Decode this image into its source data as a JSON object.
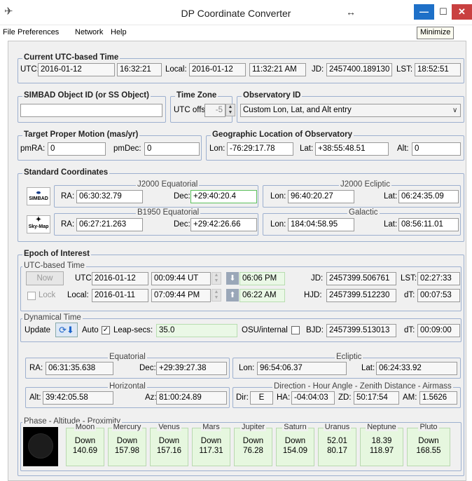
{
  "window": {
    "title": "DP Coordinate Converter",
    "tooltip": "Minimize"
  },
  "menu": [
    "File",
    "Preferences",
    "Network",
    "Help"
  ],
  "current_time": {
    "title": "Current UTC-based Time",
    "utc_label": "UTC:",
    "utc_date": "2016-01-12",
    "utc_time": "16:32:21",
    "local_label": "Local:",
    "local_date": "2016-01-12",
    "local_time": "11:32:21 AM",
    "jd_label": "JD:",
    "jd": "2457400.189130",
    "lst_label": "LST:",
    "lst": "18:52:51"
  },
  "simbad": {
    "title": "SIMBAD Object ID (or SS Object)",
    "value": ""
  },
  "timezone": {
    "title": "Time Zone",
    "label": "UTC offset",
    "value": "-5"
  },
  "observatory": {
    "title": "Observatory ID",
    "value": "Custom Lon, Lat, and Alt entry"
  },
  "proper_motion": {
    "title": "Target Proper Motion (mas/yr)",
    "pmra_label": "pmRA:",
    "pmra": "0",
    "pmdec_label": "pmDec:",
    "pmdec": "0"
  },
  "geo": {
    "title": "Geographic Location of Observatory",
    "lon_label": "Lon:",
    "lon": "-76:29:17.78",
    "lat_label": "Lat:",
    "lat": "+38:55:48.51",
    "alt_label": "Alt:",
    "alt": "0"
  },
  "standard": {
    "title": "Standard Coordinates",
    "j2000_title": "J2000 Equatorial",
    "j2000_ra_label": "RA:",
    "j2000_ra": "06:30:32.79",
    "j2000_dec_label": "Dec:",
    "j2000_dec": "+29:40:20.4",
    "ecl_title": "J2000 Ecliptic",
    "ecl_lon_label": "Lon:",
    "ecl_lon": "96:40:20.27",
    "ecl_lat_label": "Lat:",
    "ecl_lat": "06:24:35.09",
    "b1950_title": "B1950 Equatorial",
    "b1950_ra_label": "RA:",
    "b1950_ra": "06:27:21.263",
    "b1950_dec_label": "Dec:",
    "b1950_dec": "+29:42:26.66",
    "gal_title": "Galactic",
    "gal_lon_label": "Lon:",
    "gal_lon": "184:04:58.95",
    "gal_lat_label": "Lat:",
    "gal_lat": "08:56:11.01",
    "simbad_logo": "SIMBAD",
    "skymap_logo": "Sky-Map"
  },
  "epoch": {
    "title": "Epoch of Interest",
    "utc_title": "UTC-based Time",
    "now_button": "Now",
    "lock_label": "Lock",
    "utc_label": "UTC:",
    "utc_date": "2016-01-12",
    "utc_time": "00:09:44 UT",
    "local_label": "Local:",
    "local_date": "2016-01-11",
    "local_time": "07:09:44 PM",
    "set_time": "06:06 PM",
    "rise_time": "06:22 AM",
    "jd_label": "JD:",
    "jd": "2457399.506761",
    "lst_label": "LST:",
    "lst": "02:27:33",
    "hjd_label": "HJD:",
    "hjd": "2457399.512230",
    "dt_label": "dT:",
    "dt": "00:07:53"
  },
  "dynamical": {
    "title": "Dynamical Time",
    "update_label": "Update",
    "auto_label": "Auto",
    "leap_label": "Leap-secs:",
    "leap": "35.0",
    "osu_label": "OSU/internal",
    "bjd_label": "BJD:",
    "bjd": "2457399.513013",
    "dt_label": "dT:",
    "dt": "00:09:00"
  },
  "eq": {
    "title": "Equatorial",
    "ra_label": "RA:",
    "ra": "06:31:35.638",
    "dec_label": "Dec:",
    "dec": "+29:39:27.38"
  },
  "ecl": {
    "title": "Ecliptic",
    "lon_label": "Lon:",
    "lon": "96:54:06.37",
    "lat_label": "Lat:",
    "lat": "06:24:33.92"
  },
  "hor": {
    "title": "Horizontal",
    "alt_label": "Alt:",
    "alt": "39:42:05.58",
    "az_label": "Az:",
    "az": "81:00:24.89"
  },
  "direction": {
    "title": "Direction - Hour Angle - Zenith Distance - Airmass",
    "dir_label": "Dir:",
    "dir": "E",
    "ha_label": "HA:",
    "ha": "-04:04:03",
    "zd_label": "ZD:",
    "zd": "50:17:54",
    "am_label": "AM:",
    "am": "1.5626"
  },
  "phase": {
    "title": "Phase - Altitude - Proximity",
    "planets": [
      {
        "name": "Moon",
        "alt": "Down",
        "prox": "140.69"
      },
      {
        "name": "Mercury",
        "alt": "Down",
        "prox": "157.98"
      },
      {
        "name": "Venus",
        "alt": "Down",
        "prox": "157.16"
      },
      {
        "name": "Mars",
        "alt": "Down",
        "prox": "117.31"
      },
      {
        "name": "Jupiter",
        "alt": "Down",
        "prox": "76.28"
      },
      {
        "name": "Saturn",
        "alt": "Down",
        "prox": "154.09"
      },
      {
        "name": "Uranus",
        "alt": "52.01",
        "prox": "80.17"
      },
      {
        "name": "Neptune",
        "alt": "18.39",
        "prox": "118.97"
      },
      {
        "name": "Pluto",
        "alt": "Down",
        "prox": "168.55"
      }
    ]
  }
}
